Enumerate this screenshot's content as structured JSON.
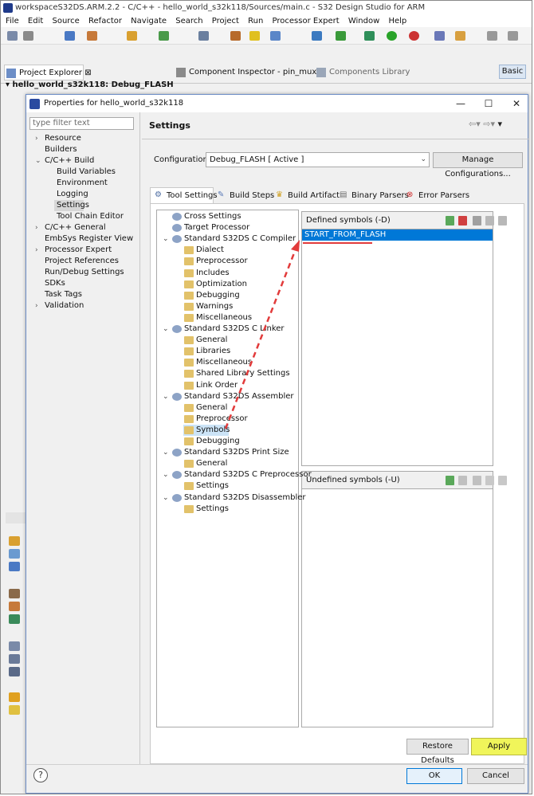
{
  "ide": {
    "title": "workspaceS32DS.ARM.2.2 - C/C++ - hello_world_s32k118/Sources/main.c - S32 Design Studio for ARM",
    "menu": [
      "File",
      "Edit",
      "Source",
      "Refactor",
      "Navigate",
      "Search",
      "Project",
      "Run",
      "Processor Expert",
      "Window",
      "Help"
    ],
    "tabs": {
      "project_explorer": "Project Explorer",
      "component_inspector": "Component Inspector - pin_mux",
      "components_library": "Components Library"
    },
    "project_root": "hello_world_s32k118: Debug_FLASH",
    "perspective": "Basic"
  },
  "dialog": {
    "title": "Properties for hello_world_s32k118",
    "filter_placeholder": "type filter text",
    "left_tree": [
      {
        "label": "Resource",
        "twisty": "›"
      },
      {
        "label": "Builders",
        "twisty": ""
      },
      {
        "label": "C/C++ Build",
        "twisty": "⌄"
      },
      {
        "label": "Build Variables",
        "twisty": ""
      },
      {
        "label": "Environment",
        "twisty": ""
      },
      {
        "label": "Logging",
        "twisty": ""
      },
      {
        "label": "Settings",
        "twisty": ""
      },
      {
        "label": "Tool Chain Editor",
        "twisty": ""
      },
      {
        "label": "C/C++ General",
        "twisty": "›"
      },
      {
        "label": "EmbSys Register View",
        "twisty": ""
      },
      {
        "label": "Processor Expert",
        "twisty": "›"
      },
      {
        "label": "Project References",
        "twisty": ""
      },
      {
        "label": "Run/Debug Settings",
        "twisty": ""
      },
      {
        "label": "SDKs",
        "twisty": ""
      },
      {
        "label": "Task Tags",
        "twisty": ""
      },
      {
        "label": "Validation",
        "twisty": "›"
      }
    ],
    "page_title": "Settings",
    "configuration_label": "Configuration:",
    "configuration_value": "Debug_FLASH  [ Active ]",
    "manage_button": "Manage Configurations...",
    "tabs": [
      "Tool Settings",
      "Build Steps",
      "Build Artifact",
      "Binary Parsers",
      "Error Parsers"
    ],
    "tool_tree": [
      {
        "label": "Cross Settings",
        "level": 1,
        "twisty": ""
      },
      {
        "label": "Target Processor",
        "level": 1,
        "twisty": ""
      },
      {
        "label": "Standard S32DS C Compiler",
        "level": 1,
        "twisty": "⌄"
      },
      {
        "label": "Dialect",
        "level": 2,
        "twisty": ""
      },
      {
        "label": "Preprocessor",
        "level": 2,
        "twisty": ""
      },
      {
        "label": "Includes",
        "level": 2,
        "twisty": ""
      },
      {
        "label": "Optimization",
        "level": 2,
        "twisty": ""
      },
      {
        "label": "Debugging",
        "level": 2,
        "twisty": ""
      },
      {
        "label": "Warnings",
        "level": 2,
        "twisty": ""
      },
      {
        "label": "Miscellaneous",
        "level": 2,
        "twisty": ""
      },
      {
        "label": "Standard S32DS C Linker",
        "level": 1,
        "twisty": "⌄"
      },
      {
        "label": "General",
        "level": 2,
        "twisty": ""
      },
      {
        "label": "Libraries",
        "level": 2,
        "twisty": ""
      },
      {
        "label": "Miscellaneous",
        "level": 2,
        "twisty": ""
      },
      {
        "label": "Shared Library Settings",
        "level": 2,
        "twisty": ""
      },
      {
        "label": "Link Order",
        "level": 2,
        "twisty": ""
      },
      {
        "label": "Standard S32DS Assembler",
        "level": 1,
        "twisty": "⌄"
      },
      {
        "label": "General",
        "level": 2,
        "twisty": ""
      },
      {
        "label": "Preprocessor",
        "level": 2,
        "twisty": ""
      },
      {
        "label": "Symbols",
        "level": 2,
        "twisty": ""
      },
      {
        "label": "Debugging",
        "level": 2,
        "twisty": ""
      },
      {
        "label": "Standard S32DS Print Size",
        "level": 1,
        "twisty": "⌄"
      },
      {
        "label": "General",
        "level": 2,
        "twisty": ""
      },
      {
        "label": "Standard S32DS C Preprocessor",
        "level": 1,
        "twisty": "⌄"
      },
      {
        "label": "Settings",
        "level": 2,
        "twisty": ""
      },
      {
        "label": "Standard S32DS Disassembler",
        "level": 1,
        "twisty": "⌄"
      },
      {
        "label": "Settings",
        "level": 2,
        "twisty": ""
      }
    ],
    "defined_header": "Defined symbols (-D)",
    "defined_item": "START_FROM_FLASH",
    "undefined_header": "Undefined symbols (-U)",
    "restore_button": "Restore Defaults",
    "apply_button": "Apply",
    "ok_button": "OK",
    "cancel_button": "Cancel",
    "help_glyph": "?"
  },
  "colors": {
    "selection": "#0078d7",
    "apply_highlight": "#f0f55a",
    "annotation_arrow": "#e23b3b"
  }
}
